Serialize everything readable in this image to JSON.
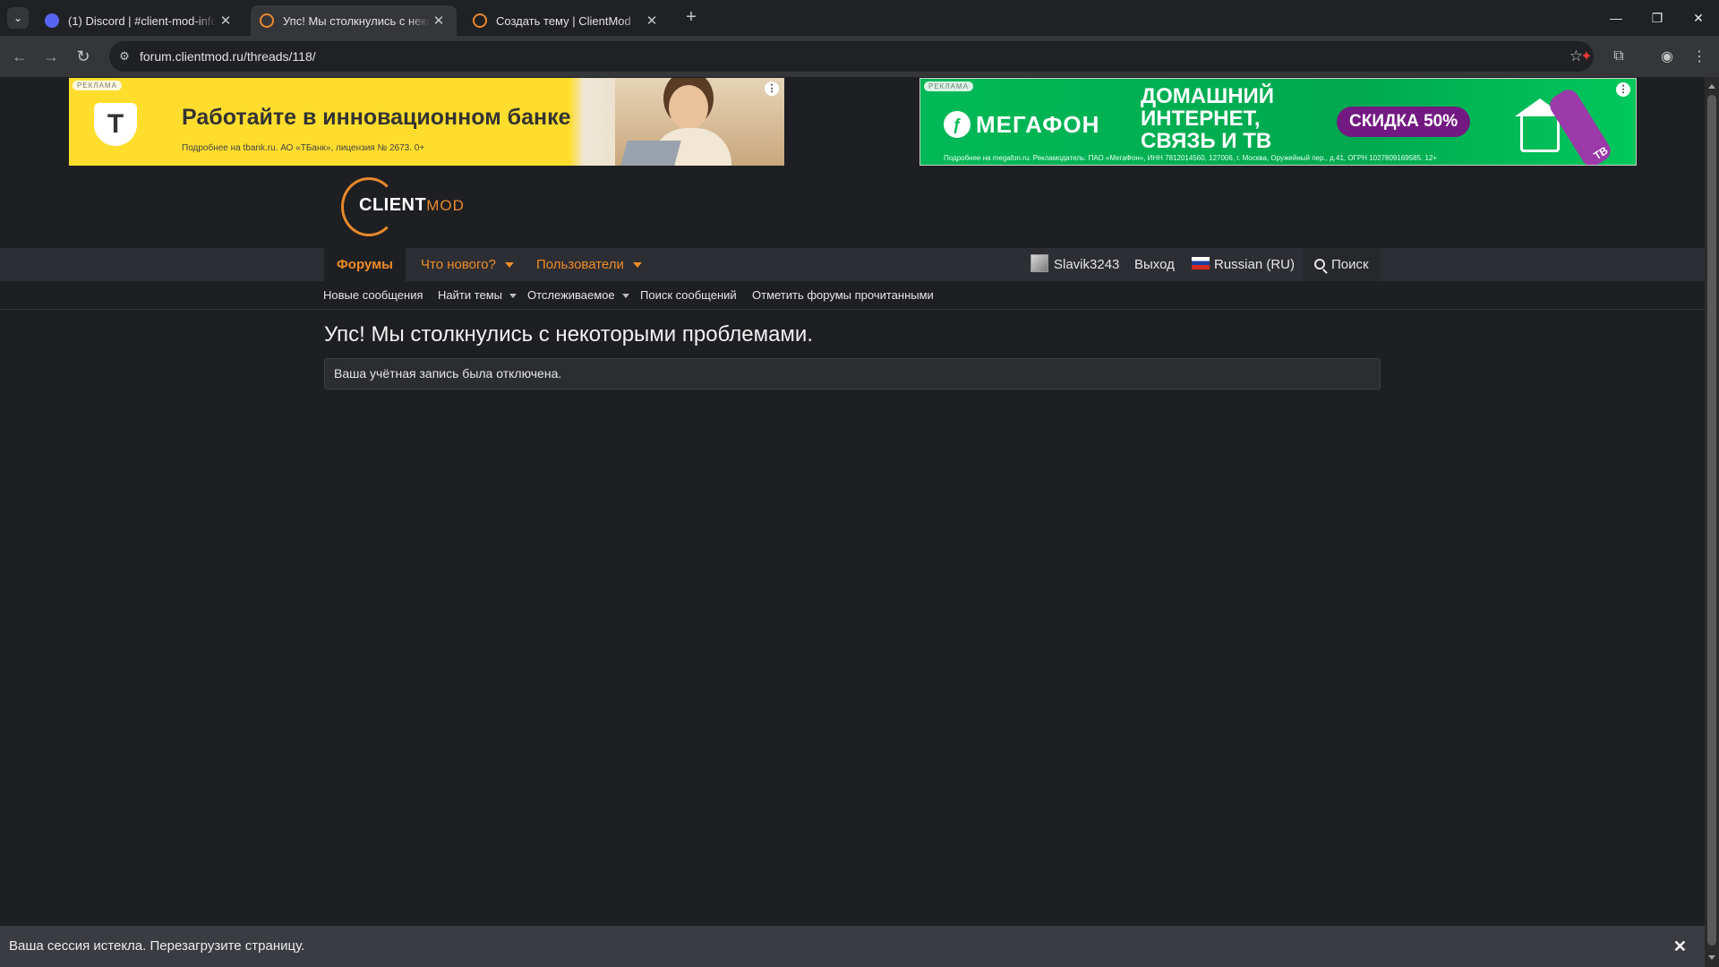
{
  "browser": {
    "tabs": [
      {
        "title": "(1) Discord | #client-mod-info |",
        "active": false
      },
      {
        "title": "Упс! Мы столкнулись с некото",
        "active": true
      },
      {
        "title": "Создать тему | ClientMod",
        "active": false
      }
    ],
    "new_tab_label": "+",
    "url": "forum.clientmod.ru/threads/118/"
  },
  "ads": {
    "left": {
      "label": "РЕКЛАМА",
      "logo_letter": "Т",
      "headline": "Работайте в инновационном банке",
      "subtext": "Подробнее на tbank.ru. АО «ТБанк», лицензия № 2673. 0+"
    },
    "right": {
      "label": "РЕКЛАМА",
      "brand": "МЕГАФОН",
      "headline": "ДОМАШНИЙ ИНТЕРНЕТ, СВЯЗЬ И ТВ",
      "badge": "СКИДКА 50%",
      "small": "Подробнее на megafon.ru. Рекламодатель: ПАО «МегаФон», ИНН 7812014560, 127006, г. Москва, Оружейный пер., д.41, ОГРН 1027809169585. 12+",
      "tv": "ТВ"
    }
  },
  "logo": {
    "client": "CLIENT",
    "mod": "MOD"
  },
  "nav": {
    "forums": "Форумы",
    "whats_new": "Что нового?",
    "members": "Пользователи",
    "username": "Slavik3243",
    "logout": "Выход",
    "language": "Russian (RU)",
    "search": "Поиск"
  },
  "subnav": {
    "new_posts": "Новые сообщения",
    "find_threads": "Найти темы",
    "watched": "Отслеживаемое",
    "search_posts": "Поиск сообщений",
    "mark_read": "Отметить форумы прочитанными"
  },
  "content": {
    "title": "Упс! Мы столкнулись с некоторыми проблемами.",
    "message": "Ваша учётная запись была отключена."
  },
  "session": {
    "message": "Ваша сессия истекла. Перезагрузите страницу.",
    "close": "✕"
  },
  "colors": {
    "accent": "#f08b26",
    "background": "#1e1f22",
    "navbar": "#2c2e33"
  }
}
